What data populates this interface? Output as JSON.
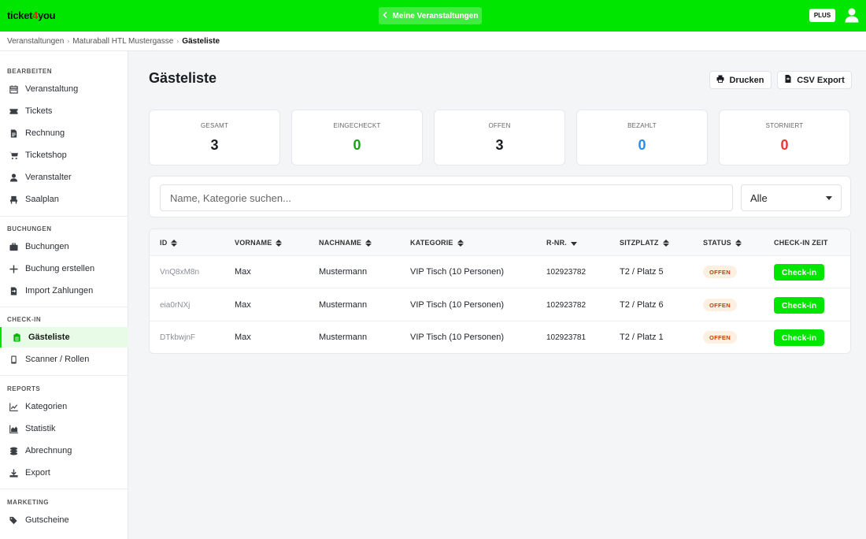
{
  "header": {
    "logo_prefix": "ticket",
    "logo_four": "4",
    "logo_suffix": "you",
    "nav_button": "Meine Veranstaltungen",
    "plan_badge": "PLUS"
  },
  "breadcrumb": [
    "Veranstaltungen",
    "Maturaball HTL Mustergasse",
    "Gästeliste"
  ],
  "sidebar": {
    "sections": [
      {
        "title": "BEARBEITEN",
        "items": [
          {
            "label": "Veranstaltung",
            "icon": "calendar-icon"
          },
          {
            "label": "Tickets",
            "icon": "ticket-icon"
          },
          {
            "label": "Rechnung",
            "icon": "invoice-icon"
          },
          {
            "label": "Ticketshop",
            "icon": "cart-icon"
          },
          {
            "label": "Veranstalter",
            "icon": "user-icon"
          },
          {
            "label": "Saalplan",
            "icon": "seat-icon"
          }
        ]
      },
      {
        "title": "BUCHUNGEN",
        "items": [
          {
            "label": "Buchungen",
            "icon": "briefcase-icon"
          },
          {
            "label": "Buchung erstellen",
            "icon": "plus-icon"
          },
          {
            "label": "Import Zahlungen",
            "icon": "file-import-icon"
          }
        ]
      },
      {
        "title": "CHECK-IN",
        "items": [
          {
            "label": "Gästeliste",
            "icon": "clipboard-list-icon",
            "active": true
          },
          {
            "label": "Scanner / Rollen",
            "icon": "mobile-icon"
          }
        ]
      },
      {
        "title": "REPORTS",
        "items": [
          {
            "label": "Kategorien",
            "icon": "line-chart-icon"
          },
          {
            "label": "Statistik",
            "icon": "area-chart-icon"
          },
          {
            "label": "Abrechnung",
            "icon": "coins-icon"
          },
          {
            "label": "Export",
            "icon": "download-icon"
          }
        ]
      },
      {
        "title": "MARKETING",
        "items": [
          {
            "label": "Gutscheine",
            "icon": "tags-icon"
          }
        ]
      }
    ]
  },
  "main": {
    "title": "Gästeliste",
    "print_button": "Drucken",
    "csv_button": "CSV Export",
    "stats": [
      {
        "label": "GESAMT",
        "value": "3",
        "color": "#1a1d21"
      },
      {
        "label": "EINGECHECKT",
        "value": "0",
        "color": "#16a316"
      },
      {
        "label": "OFFEN",
        "value": "3",
        "color": "#1a1d21"
      },
      {
        "label": "BEZAHLT",
        "value": "0",
        "color": "#2b8ce6"
      },
      {
        "label": "STORNIERT",
        "value": "0",
        "color": "#e53935"
      }
    ],
    "search": {
      "placeholder": "Name, Kategorie suchen...",
      "value": ""
    },
    "filter": {
      "selected": "Alle"
    },
    "table": {
      "columns": [
        "ID",
        "VORNAME",
        "NACHNAME",
        "KATEGORIE",
        "R-NR.",
        "SITZPLATZ",
        "STATUS",
        "CHECK-IN ZEIT"
      ],
      "rows": [
        {
          "id": "VnQ8xM8n",
          "vorname": "Max",
          "nachname": "Mustermann",
          "kategorie": "VIP Tisch (10 Personen)",
          "rnr": "102923782",
          "sitzplatz": "T2 / Platz 5",
          "status": "OFFEN",
          "action": "Check-in"
        },
        {
          "id": "eia0rNXj",
          "vorname": "Max",
          "nachname": "Mustermann",
          "kategorie": "VIP Tisch (10 Personen)",
          "rnr": "102923782",
          "sitzplatz": "T2 / Platz 6",
          "status": "OFFEN",
          "action": "Check-in"
        },
        {
          "id": "DTkbwjnF",
          "vorname": "Max",
          "nachname": "Mustermann",
          "kategorie": "VIP Tisch (10 Personen)",
          "rnr": "102923781",
          "sitzplatz": "T2 / Platz 1",
          "status": "OFFEN",
          "action": "Check-in"
        }
      ]
    }
  },
  "colors": {
    "brand": "#00e600",
    "status_open_bg": "#fdf0e1",
    "status_open_text": "#c2410c"
  }
}
